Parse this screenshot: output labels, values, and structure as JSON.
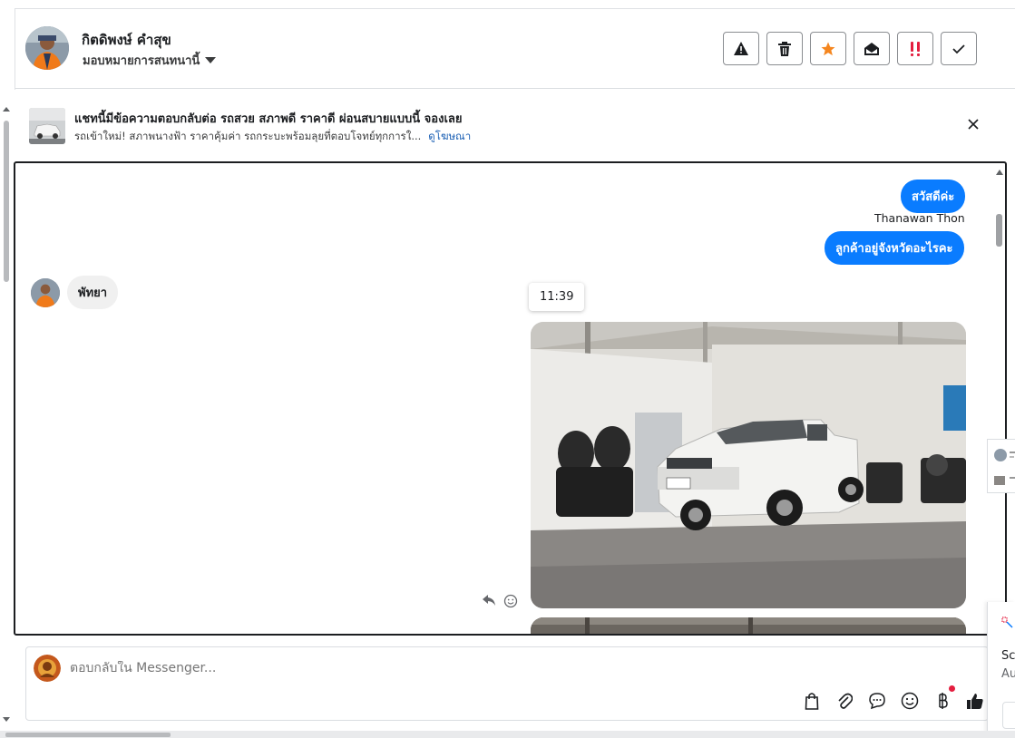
{
  "header": {
    "contact_name": "กิตดิพงษ์ คำสุข",
    "assign_label": "มอบหมายการสนทนานี้",
    "tools": [
      "spam-icon",
      "trash-icon",
      "star-icon",
      "mark-unread-icon",
      "important-icon",
      "done-icon"
    ],
    "star_color": "#f5861f",
    "important_color": "#e41e3f"
  },
  "ad": {
    "title": "แชทนี้มีข้อความตอบกลับต่อ รถสวย สภาพดี ราคาดี ผ่อนสบายแบบนี้ จองเลย",
    "subtitle": "รถเข้าใหม่! สภาพนางฟ้า ราคาคุ้มค่า รถกระบะพร้อมลุยที่ตอบโจทย์ทุกการใ...",
    "link": "ดูโฆษณา"
  },
  "chat": {
    "messages_out": [
      "สวัสดีค่ะ",
      "ลูกค้าอยู่จังหวัดอะไรคะ"
    ],
    "sender": "Thanawan Thon",
    "message_in": "พัทยา",
    "time": "11:39",
    "accent": "#0a7cff"
  },
  "composer": {
    "placeholder": "ตอบกลับใน Messenger..."
  },
  "side_panel": {
    "line1": "Sc",
    "line2": "Au"
  }
}
